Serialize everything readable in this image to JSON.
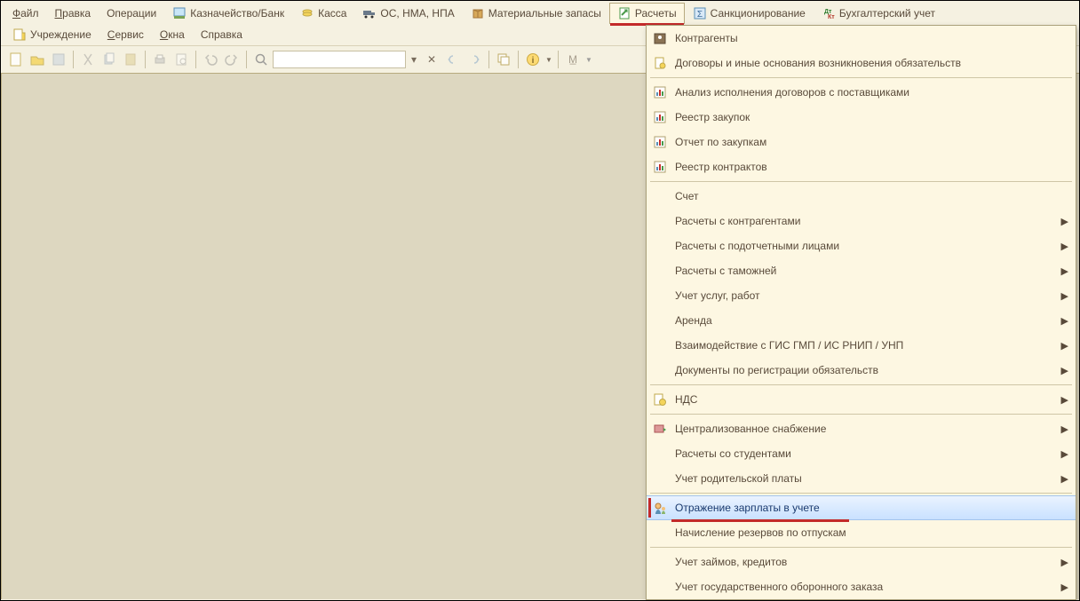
{
  "menubar": {
    "row1": [
      {
        "label": "Файл",
        "uchar": "Ф"
      },
      {
        "label": "Правка",
        "uchar": "П"
      },
      {
        "label": "Операции"
      },
      {
        "label": "Казначейство/Банк",
        "icon": "bank"
      },
      {
        "label": "Касса",
        "icon": "cash"
      },
      {
        "label": "ОС, НМА, НПА",
        "icon": "truck"
      },
      {
        "label": "Материальные запасы",
        "icon": "box"
      },
      {
        "label": "Расчеты",
        "icon": "calc",
        "active": true,
        "redline": true
      },
      {
        "label": "Санкционирование",
        "icon": "sigma"
      },
      {
        "label": "Бухгалтерский учет",
        "icon": "dtdt"
      }
    ],
    "row2": [
      {
        "label": "Учреждение",
        "icon": "org"
      },
      {
        "label": "Сервис",
        "uchar": "С"
      },
      {
        "label": "Окна",
        "uchar": "О"
      },
      {
        "label": "Справка"
      }
    ]
  },
  "dropdown": [
    {
      "label": "Контрагенты",
      "icon": "people"
    },
    {
      "label": "Договоры и иные основания возникновения обязательств",
      "icon": "doc"
    },
    {
      "sep": true
    },
    {
      "label": "Анализ исполнения договоров с поставщиками",
      "icon": "chart"
    },
    {
      "label": "Реестр закупок",
      "icon": "chart"
    },
    {
      "label": "Отчет по закупкам",
      "icon": "chart"
    },
    {
      "label": "Реестр контрактов",
      "icon": "chart"
    },
    {
      "sep": true
    },
    {
      "label": "Счет"
    },
    {
      "label": "Расчеты с контрагентами",
      "sub": true
    },
    {
      "label": "Расчеты с подотчетными лицами",
      "sub": true
    },
    {
      "label": "Расчеты с таможней",
      "sub": true
    },
    {
      "label": "Учет услуг, работ",
      "sub": true
    },
    {
      "label": "Аренда",
      "sub": true
    },
    {
      "label": "Взаимодействие с ГИС ГМП / ИС РНИП / УНП",
      "sub": true
    },
    {
      "label": "Документы по регистрации обязательств",
      "sub": true
    },
    {
      "sep": true
    },
    {
      "label": "НДС",
      "icon": "nds",
      "sub": true
    },
    {
      "sep": true
    },
    {
      "label": "Централизованное снабжение",
      "icon": "supply",
      "sub": true
    },
    {
      "label": "Расчеты со студентами",
      "sub": true
    },
    {
      "label": "Учет родительской платы",
      "sub": true
    },
    {
      "sep": true
    },
    {
      "label": "Отражение зарплаты в учете",
      "icon": "salary",
      "hover": true,
      "redbar": true,
      "redline": true
    },
    {
      "label": "Начисление резервов по отпускам"
    },
    {
      "sep": true
    },
    {
      "label": "Учет займов, кредитов",
      "sub": true
    },
    {
      "label": "Учет государственного оборонного заказа",
      "sub": true
    }
  ]
}
